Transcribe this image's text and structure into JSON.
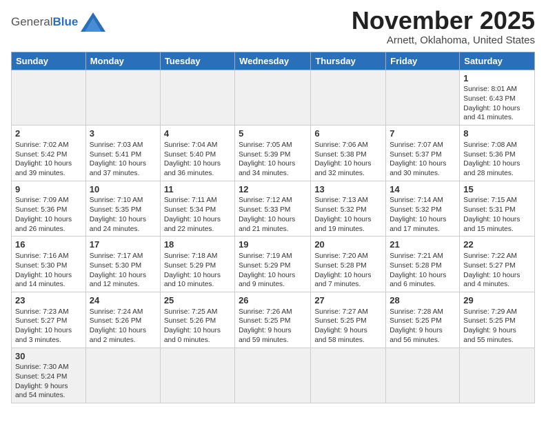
{
  "header": {
    "logo_general": "General",
    "logo_blue": "Blue",
    "month_title": "November 2025",
    "subtitle": "Arnett, Oklahoma, United States"
  },
  "days_of_week": [
    "Sunday",
    "Monday",
    "Tuesday",
    "Wednesday",
    "Thursday",
    "Friday",
    "Saturday"
  ],
  "weeks": [
    [
      {
        "day": "",
        "info": "",
        "shaded": true
      },
      {
        "day": "",
        "info": "",
        "shaded": true
      },
      {
        "day": "",
        "info": "",
        "shaded": true
      },
      {
        "day": "",
        "info": "",
        "shaded": true
      },
      {
        "day": "",
        "info": "",
        "shaded": true
      },
      {
        "day": "",
        "info": "",
        "shaded": true
      },
      {
        "day": "1",
        "info": "Sunrise: 8:01 AM\nSunset: 6:43 PM\nDaylight: 10 hours\nand 41 minutes."
      }
    ],
    [
      {
        "day": "2",
        "info": "Sunrise: 7:02 AM\nSunset: 5:42 PM\nDaylight: 10 hours\nand 39 minutes."
      },
      {
        "day": "3",
        "info": "Sunrise: 7:03 AM\nSunset: 5:41 PM\nDaylight: 10 hours\nand 37 minutes."
      },
      {
        "day": "4",
        "info": "Sunrise: 7:04 AM\nSunset: 5:40 PM\nDaylight: 10 hours\nand 36 minutes."
      },
      {
        "day": "5",
        "info": "Sunrise: 7:05 AM\nSunset: 5:39 PM\nDaylight: 10 hours\nand 34 minutes."
      },
      {
        "day": "6",
        "info": "Sunrise: 7:06 AM\nSunset: 5:38 PM\nDaylight: 10 hours\nand 32 minutes."
      },
      {
        "day": "7",
        "info": "Sunrise: 7:07 AM\nSunset: 5:37 PM\nDaylight: 10 hours\nand 30 minutes."
      },
      {
        "day": "8",
        "info": "Sunrise: 7:08 AM\nSunset: 5:36 PM\nDaylight: 10 hours\nand 28 minutes."
      }
    ],
    [
      {
        "day": "9",
        "info": "Sunrise: 7:09 AM\nSunset: 5:36 PM\nDaylight: 10 hours\nand 26 minutes."
      },
      {
        "day": "10",
        "info": "Sunrise: 7:10 AM\nSunset: 5:35 PM\nDaylight: 10 hours\nand 24 minutes."
      },
      {
        "day": "11",
        "info": "Sunrise: 7:11 AM\nSunset: 5:34 PM\nDaylight: 10 hours\nand 22 minutes."
      },
      {
        "day": "12",
        "info": "Sunrise: 7:12 AM\nSunset: 5:33 PM\nDaylight: 10 hours\nand 21 minutes."
      },
      {
        "day": "13",
        "info": "Sunrise: 7:13 AM\nSunset: 5:32 PM\nDaylight: 10 hours\nand 19 minutes."
      },
      {
        "day": "14",
        "info": "Sunrise: 7:14 AM\nSunset: 5:32 PM\nDaylight: 10 hours\nand 17 minutes."
      },
      {
        "day": "15",
        "info": "Sunrise: 7:15 AM\nSunset: 5:31 PM\nDaylight: 10 hours\nand 15 minutes."
      }
    ],
    [
      {
        "day": "16",
        "info": "Sunrise: 7:16 AM\nSunset: 5:30 PM\nDaylight: 10 hours\nand 14 minutes."
      },
      {
        "day": "17",
        "info": "Sunrise: 7:17 AM\nSunset: 5:30 PM\nDaylight: 10 hours\nand 12 minutes."
      },
      {
        "day": "18",
        "info": "Sunrise: 7:18 AM\nSunset: 5:29 PM\nDaylight: 10 hours\nand 10 minutes."
      },
      {
        "day": "19",
        "info": "Sunrise: 7:19 AM\nSunset: 5:29 PM\nDaylight: 10 hours\nand 9 minutes."
      },
      {
        "day": "20",
        "info": "Sunrise: 7:20 AM\nSunset: 5:28 PM\nDaylight: 10 hours\nand 7 minutes."
      },
      {
        "day": "21",
        "info": "Sunrise: 7:21 AM\nSunset: 5:28 PM\nDaylight: 10 hours\nand 6 minutes."
      },
      {
        "day": "22",
        "info": "Sunrise: 7:22 AM\nSunset: 5:27 PM\nDaylight: 10 hours\nand 4 minutes."
      }
    ],
    [
      {
        "day": "23",
        "info": "Sunrise: 7:23 AM\nSunset: 5:27 PM\nDaylight: 10 hours\nand 3 minutes."
      },
      {
        "day": "24",
        "info": "Sunrise: 7:24 AM\nSunset: 5:26 PM\nDaylight: 10 hours\nand 2 minutes."
      },
      {
        "day": "25",
        "info": "Sunrise: 7:25 AM\nSunset: 5:26 PM\nDaylight: 10 hours\nand 0 minutes."
      },
      {
        "day": "26",
        "info": "Sunrise: 7:26 AM\nSunset: 5:25 PM\nDaylight: 9 hours\nand 59 minutes."
      },
      {
        "day": "27",
        "info": "Sunrise: 7:27 AM\nSunset: 5:25 PM\nDaylight: 9 hours\nand 58 minutes."
      },
      {
        "day": "28",
        "info": "Sunrise: 7:28 AM\nSunset: 5:25 PM\nDaylight: 9 hours\nand 56 minutes."
      },
      {
        "day": "29",
        "info": "Sunrise: 7:29 AM\nSunset: 5:25 PM\nDaylight: 9 hours\nand 55 minutes."
      }
    ],
    [
      {
        "day": "30",
        "info": "Sunrise: 7:30 AM\nSunset: 5:24 PM\nDaylight: 9 hours\nand 54 minutes.",
        "has_data": true
      },
      {
        "day": "",
        "info": "",
        "shaded": true
      },
      {
        "day": "",
        "info": "",
        "shaded": true
      },
      {
        "day": "",
        "info": "",
        "shaded": true
      },
      {
        "day": "",
        "info": "",
        "shaded": true
      },
      {
        "day": "",
        "info": "",
        "shaded": true
      },
      {
        "day": "",
        "info": "",
        "shaded": true
      }
    ]
  ]
}
